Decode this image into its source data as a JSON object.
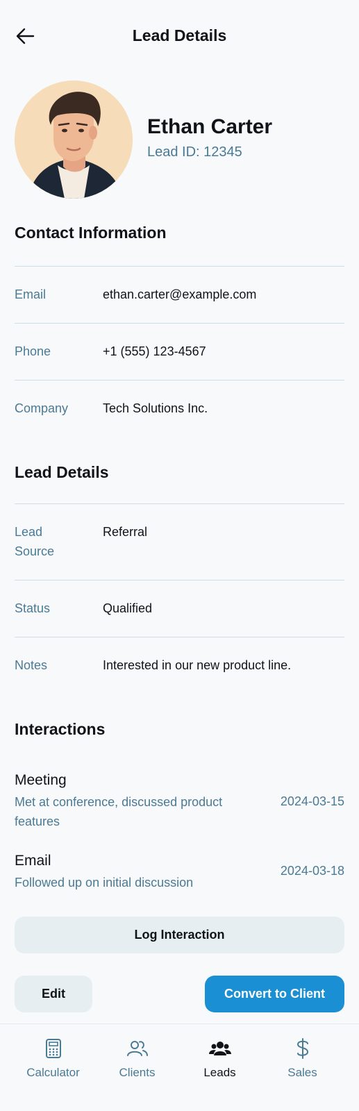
{
  "header": {
    "title": "Lead Details"
  },
  "profile": {
    "name": "Ethan Carter",
    "lead_id": "Lead ID: 12345"
  },
  "contact": {
    "title": "Contact Information",
    "rows": [
      {
        "label": "Email",
        "value": "ethan.carter@example.com"
      },
      {
        "label": "Phone",
        "value": "+1 (555) 123-4567"
      },
      {
        "label": "Company",
        "value": "Tech Solutions Inc."
      }
    ]
  },
  "lead_details": {
    "title": "Lead Details",
    "rows": [
      {
        "label_line1": "Lead",
        "label_line2": "Source",
        "value": "Referral"
      },
      {
        "label": "Status",
        "value": "Qualified"
      },
      {
        "label": "Notes",
        "value": "Interested in our new product line."
      }
    ]
  },
  "interactions": {
    "title": "Interactions",
    "items": [
      {
        "type": "Meeting",
        "desc_line1": "Met at conference, discussed product",
        "desc_line2": "features",
        "date": "2024-03-15"
      },
      {
        "type": "Email",
        "desc": "Followed up on initial discussion",
        "date": "2024-03-18"
      }
    ]
  },
  "actions": {
    "log": "Log Interaction",
    "edit": "Edit",
    "convert": "Convert to Client"
  },
  "nav": {
    "active": "Leads",
    "items": [
      {
        "label": "Calculator",
        "icon": "calculator-icon"
      },
      {
        "label": "Clients",
        "icon": "users-icon"
      },
      {
        "label": "Leads",
        "icon": "group-icon"
      },
      {
        "label": "Sales",
        "icon": "dollar-icon"
      }
    ]
  },
  "colors": {
    "accent": "#1a8fd4",
    "muted_text": "#4a7a94",
    "background": "#f7f9fb"
  }
}
